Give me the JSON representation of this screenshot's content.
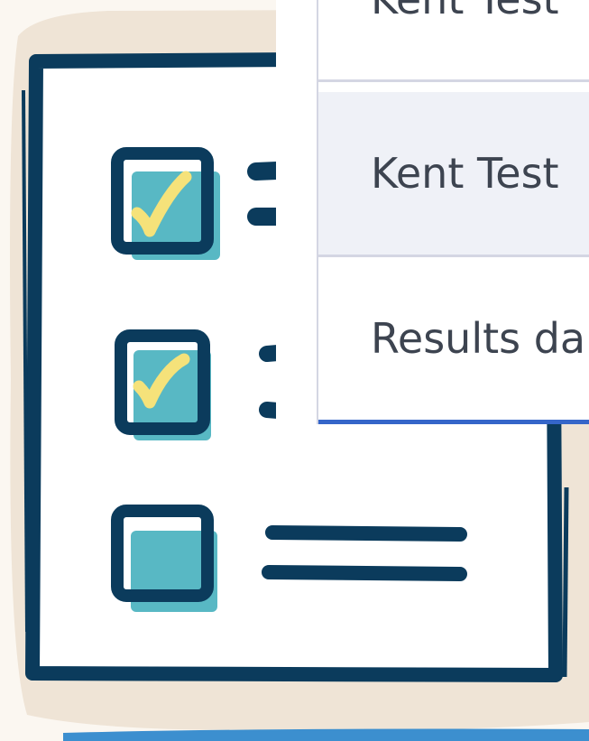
{
  "menu": {
    "items": [
      {
        "label": "Kent Test"
      },
      {
        "label": "Kent Test"
      },
      {
        "label": "Results da"
      }
    ]
  },
  "illustration": {
    "icon": "checklist-icon",
    "checkboxes": [
      {
        "checked": true
      },
      {
        "checked": true
      },
      {
        "checked": false
      }
    ]
  },
  "colors": {
    "ink": "#0b3b5c",
    "teal": "#58b8c4",
    "yellow": "#f5e27a",
    "paper": "#efe4d6",
    "menu_divider": "#d4d6e3",
    "menu_hover": "#eff1f7",
    "menu_accent": "#3566c9",
    "menu_text": "#3d4450"
  }
}
